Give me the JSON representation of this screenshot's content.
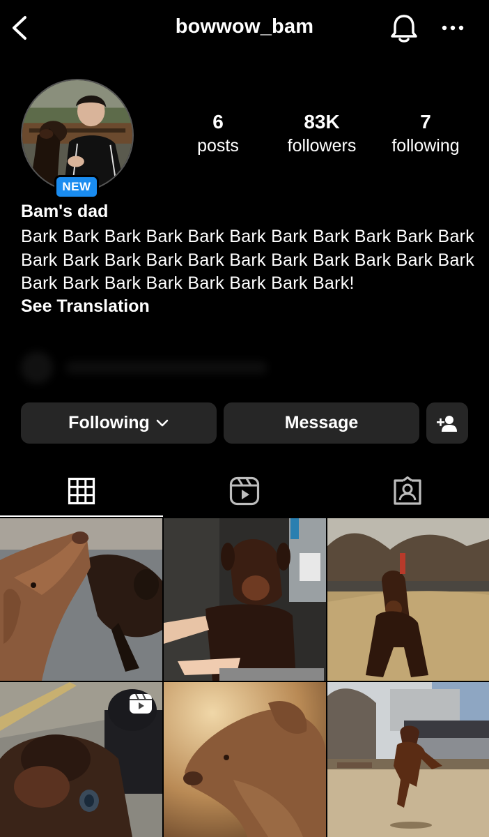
{
  "header": {
    "username": "bowwow_bam",
    "back_icon": "chevron-left-icon",
    "bell_icon": "bell-icon",
    "more_icon": "more-horizontal-icon"
  },
  "profile": {
    "badge": "NEW",
    "display_name": "Bam's dad",
    "bio": "Bark Bark Bark Bark Bark Bark Bark Bark Bark Bark Bark Bark Bark Bark Bark Bark Bark Bark Bark Bark Bark Bark Bark Bark Bark Bark Bark Bark Bark Bark!",
    "see_translation": "See Translation"
  },
  "stats": {
    "posts": {
      "value": "6",
      "label": "posts"
    },
    "followers": {
      "value": "83K",
      "label": "followers"
    },
    "following": {
      "value": "7",
      "label": "following"
    }
  },
  "actions": {
    "following_label": "Following",
    "message_label": "Message",
    "add_user_icon": "add-user-icon"
  },
  "tabs": [
    {
      "name": "posts-grid",
      "icon": "grid-icon",
      "active": true
    },
    {
      "name": "reels",
      "icon": "reels-icon",
      "active": false
    },
    {
      "name": "tagged",
      "icon": "tagged-person-icon",
      "active": false
    }
  ],
  "posts": [
    {
      "subject": "doberman looking up",
      "is_reel": false
    },
    {
      "subject": "doberman being bathed",
      "is_reel": false
    },
    {
      "subject": "doberman sitting on grass",
      "is_reel": false
    },
    {
      "subject": "doberman close-up nose",
      "is_reel": true
    },
    {
      "subject": "doberman profile in warm light",
      "is_reel": false
    },
    {
      "subject": "doberman running in dog park",
      "is_reel": false
    }
  ],
  "colors": {
    "background": "#000000",
    "button": "#262626",
    "badge": "#1a8cf0",
    "text": "#ffffff"
  }
}
